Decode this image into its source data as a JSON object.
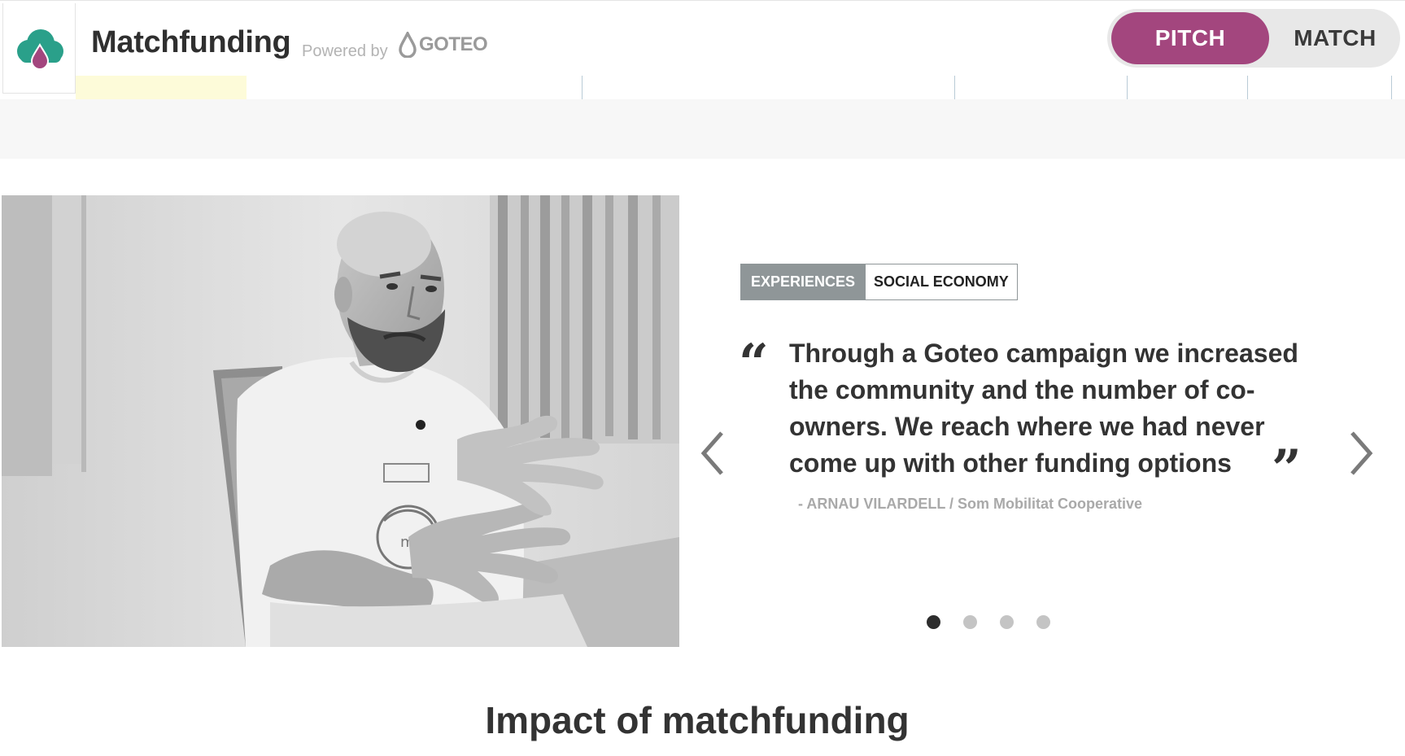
{
  "header": {
    "brand_title": "Matchfunding",
    "powered_by": "Powered by",
    "goteo_label": "GOTEO",
    "logo_icon": "cloud-drop-icon",
    "toggle": {
      "pitch_label": "PITCH",
      "match_label": "MATCH",
      "active": "PITCH"
    }
  },
  "colors": {
    "brand_green": "#2aa08a",
    "brand_magenta": "#a3467e",
    "toggle_bg": "#e8e8e8",
    "tag_gray": "#8f9698",
    "nav_highlight": "#fdfbd9"
  },
  "testimonial": {
    "tags": [
      "EXPERIENCES",
      "SOCIAL ECONOMY"
    ],
    "quote": "Through a Goteo campaign we increased the community and the number of co-owners. We reach where we had never come up with other funding options",
    "author": "- ARNAU VILARDELL / Som Mobilitat Cooperative",
    "slide_count": 4,
    "active_slide": 1,
    "prev_icon": "chevron-left-icon",
    "next_icon": "chevron-right-icon"
  },
  "section": {
    "title": "Impact of matchfunding"
  }
}
